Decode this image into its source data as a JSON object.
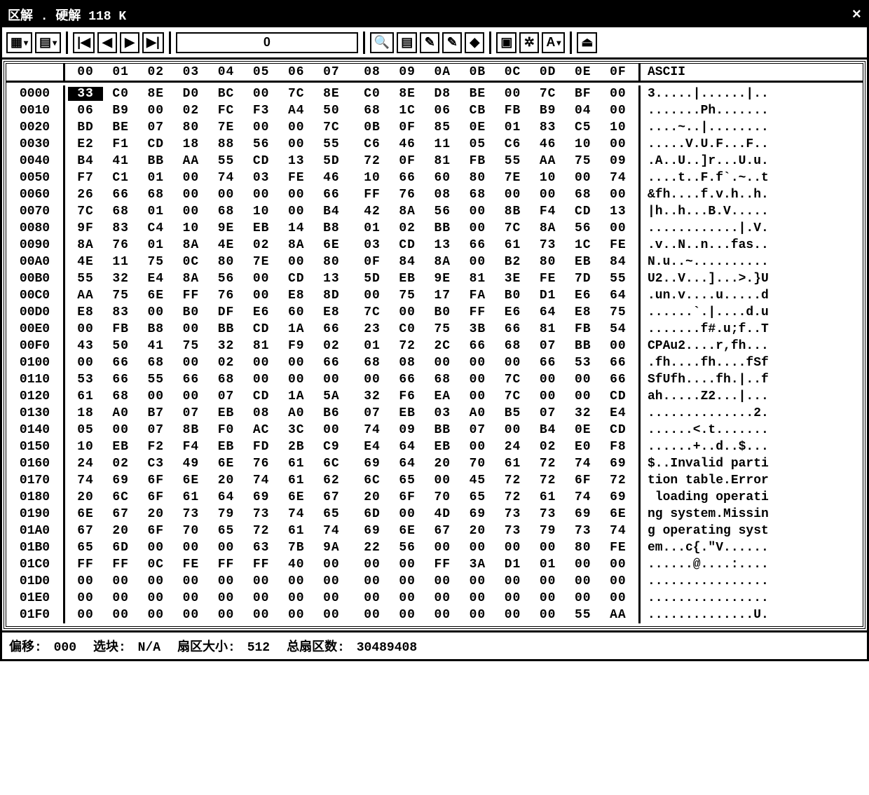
{
  "title": "区解 . 硬解 118 K",
  "close_label": "×",
  "toolbar": {
    "offset_value": "0"
  },
  "header": {
    "cols": [
      "00",
      "01",
      "02",
      "03",
      "04",
      "05",
      "06",
      "07",
      "08",
      "09",
      "0A",
      "0B",
      "0C",
      "0D",
      "0E",
      "0F"
    ],
    "ascii_label": "ASCII"
  },
  "rows": [
    {
      "addr": "0000",
      "hex": [
        "33",
        "C0",
        "8E",
        "D0",
        "BC",
        "00",
        "7C",
        "8E",
        "C0",
        "8E",
        "D8",
        "BE",
        "00",
        "7C",
        "BF",
        "00"
      ],
      "ascii": "3.....|......|.."
    },
    {
      "addr": "0010",
      "hex": [
        "06",
        "B9",
        "00",
        "02",
        "FC",
        "F3",
        "A4",
        "50",
        "68",
        "1C",
        "06",
        "CB",
        "FB",
        "B9",
        "04",
        "00"
      ],
      "ascii": ".......Ph......."
    },
    {
      "addr": "0020",
      "hex": [
        "BD",
        "BE",
        "07",
        "80",
        "7E",
        "00",
        "00",
        "7C",
        "0B",
        "0F",
        "85",
        "0E",
        "01",
        "83",
        "C5",
        "10"
      ],
      "ascii": "....~..|........"
    },
    {
      "addr": "0030",
      "hex": [
        "E2",
        "F1",
        "CD",
        "18",
        "88",
        "56",
        "00",
        "55",
        "C6",
        "46",
        "11",
        "05",
        "C6",
        "46",
        "10",
        "00"
      ],
      "ascii": ".....V.U.F...F.."
    },
    {
      "addr": "0040",
      "hex": [
        "B4",
        "41",
        "BB",
        "AA",
        "55",
        "CD",
        "13",
        "5D",
        "72",
        "0F",
        "81",
        "FB",
        "55",
        "AA",
        "75",
        "09"
      ],
      "ascii": ".A..U..]r...U.u."
    },
    {
      "addr": "0050",
      "hex": [
        "F7",
        "C1",
        "01",
        "00",
        "74",
        "03",
        "FE",
        "46",
        "10",
        "66",
        "60",
        "80",
        "7E",
        "10",
        "00",
        "74"
      ],
      "ascii": "....t..F.f`.~..t"
    },
    {
      "addr": "0060",
      "hex": [
        "26",
        "66",
        "68",
        "00",
        "00",
        "00",
        "00",
        "66",
        "FF",
        "76",
        "08",
        "68",
        "00",
        "00",
        "68",
        "00"
      ],
      "ascii": "&fh....f.v.h..h."
    },
    {
      "addr": "0070",
      "hex": [
        "7C",
        "68",
        "01",
        "00",
        "68",
        "10",
        "00",
        "B4",
        "42",
        "8A",
        "56",
        "00",
        "8B",
        "F4",
        "CD",
        "13"
      ],
      "ascii": "|h..h...B.V....."
    },
    {
      "addr": "0080",
      "hex": [
        "9F",
        "83",
        "C4",
        "10",
        "9E",
        "EB",
        "14",
        "B8",
        "01",
        "02",
        "BB",
        "00",
        "7C",
        "8A",
        "56",
        "00"
      ],
      "ascii": "............|.V."
    },
    {
      "addr": "0090",
      "hex": [
        "8A",
        "76",
        "01",
        "8A",
        "4E",
        "02",
        "8A",
        "6E",
        "03",
        "CD",
        "13",
        "66",
        "61",
        "73",
        "1C",
        "FE"
      ],
      "ascii": ".v..N..n...fas.."
    },
    {
      "addr": "00A0",
      "hex": [
        "4E",
        "11",
        "75",
        "0C",
        "80",
        "7E",
        "00",
        "80",
        "0F",
        "84",
        "8A",
        "00",
        "B2",
        "80",
        "EB",
        "84"
      ],
      "ascii": "N.u..~.........."
    },
    {
      "addr": "00B0",
      "hex": [
        "55",
        "32",
        "E4",
        "8A",
        "56",
        "00",
        "CD",
        "13",
        "5D",
        "EB",
        "9E",
        "81",
        "3E",
        "FE",
        "7D",
        "55"
      ],
      "ascii": "U2..V...]...>.}U"
    },
    {
      "addr": "00C0",
      "hex": [
        "AA",
        "75",
        "6E",
        "FF",
        "76",
        "00",
        "E8",
        "8D",
        "00",
        "75",
        "17",
        "FA",
        "B0",
        "D1",
        "E6",
        "64"
      ],
      "ascii": ".un.v....u.....d"
    },
    {
      "addr": "00D0",
      "hex": [
        "E8",
        "83",
        "00",
        "B0",
        "DF",
        "E6",
        "60",
        "E8",
        "7C",
        "00",
        "B0",
        "FF",
        "E6",
        "64",
        "E8",
        "75"
      ],
      "ascii": "......`.|....d.u"
    },
    {
      "addr": "00E0",
      "hex": [
        "00",
        "FB",
        "B8",
        "00",
        "BB",
        "CD",
        "1A",
        "66",
        "23",
        "C0",
        "75",
        "3B",
        "66",
        "81",
        "FB",
        "54"
      ],
      "ascii": ".......f#.u;f..T"
    },
    {
      "addr": "00F0",
      "hex": [
        "43",
        "50",
        "41",
        "75",
        "32",
        "81",
        "F9",
        "02",
        "01",
        "72",
        "2C",
        "66",
        "68",
        "07",
        "BB",
        "00"
      ],
      "ascii": "CPAu2....r,fh..."
    },
    {
      "addr": "0100",
      "hex": [
        "00",
        "66",
        "68",
        "00",
        "02",
        "00",
        "00",
        "66",
        "68",
        "08",
        "00",
        "00",
        "00",
        "66",
        "53",
        "66"
      ],
      "ascii": ".fh....fh....fSf"
    },
    {
      "addr": "0110",
      "hex": [
        "53",
        "66",
        "55",
        "66",
        "68",
        "00",
        "00",
        "00",
        "00",
        "66",
        "68",
        "00",
        "7C",
        "00",
        "00",
        "66"
      ],
      "ascii": "SfUfh....fh.|..f"
    },
    {
      "addr": "0120",
      "hex": [
        "61",
        "68",
        "00",
        "00",
        "07",
        "CD",
        "1A",
        "5A",
        "32",
        "F6",
        "EA",
        "00",
        "7C",
        "00",
        "00",
        "CD"
      ],
      "ascii": "ah.....Z2...|..."
    },
    {
      "addr": "0130",
      "hex": [
        "18",
        "A0",
        "B7",
        "07",
        "EB",
        "08",
        "A0",
        "B6",
        "07",
        "EB",
        "03",
        "A0",
        "B5",
        "07",
        "32",
        "E4"
      ],
      "ascii": "..............2."
    },
    {
      "addr": "0140",
      "hex": [
        "05",
        "00",
        "07",
        "8B",
        "F0",
        "AC",
        "3C",
        "00",
        "74",
        "09",
        "BB",
        "07",
        "00",
        "B4",
        "0E",
        "CD"
      ],
      "ascii": "......<.t......."
    },
    {
      "addr": "0150",
      "hex": [
        "10",
        "EB",
        "F2",
        "F4",
        "EB",
        "FD",
        "2B",
        "C9",
        "E4",
        "64",
        "EB",
        "00",
        "24",
        "02",
        "E0",
        "F8"
      ],
      "ascii": "......+..d..$..."
    },
    {
      "addr": "0160",
      "hex": [
        "24",
        "02",
        "C3",
        "49",
        "6E",
        "76",
        "61",
        "6C",
        "69",
        "64",
        "20",
        "70",
        "61",
        "72",
        "74",
        "69"
      ],
      "ascii": "$..Invalid parti"
    },
    {
      "addr": "0170",
      "hex": [
        "74",
        "69",
        "6F",
        "6E",
        "20",
        "74",
        "61",
        "62",
        "6C",
        "65",
        "00",
        "45",
        "72",
        "72",
        "6F",
        "72"
      ],
      "ascii": "tion table.Error"
    },
    {
      "addr": "0180",
      "hex": [
        "20",
        "6C",
        "6F",
        "61",
        "64",
        "69",
        "6E",
        "67",
        "20",
        "6F",
        "70",
        "65",
        "72",
        "61",
        "74",
        "69"
      ],
      "ascii": " loading operati"
    },
    {
      "addr": "0190",
      "hex": [
        "6E",
        "67",
        "20",
        "73",
        "79",
        "73",
        "74",
        "65",
        "6D",
        "00",
        "4D",
        "69",
        "73",
        "73",
        "69",
        "6E"
      ],
      "ascii": "ng system.Missin"
    },
    {
      "addr": "01A0",
      "hex": [
        "67",
        "20",
        "6F",
        "70",
        "65",
        "72",
        "61",
        "74",
        "69",
        "6E",
        "67",
        "20",
        "73",
        "79",
        "73",
        "74"
      ],
      "ascii": "g operating syst"
    },
    {
      "addr": "01B0",
      "hex": [
        "65",
        "6D",
        "00",
        "00",
        "00",
        "63",
        "7B",
        "9A",
        "22",
        "56",
        "00",
        "00",
        "00",
        "00",
        "80",
        "FE"
      ],
      "ascii": "em...c{.\"V......"
    },
    {
      "addr": "01C0",
      "hex": [
        "FF",
        "FF",
        "0C",
        "FE",
        "FF",
        "FF",
        "40",
        "00",
        "00",
        "00",
        "FF",
        "3A",
        "D1",
        "01",
        "00",
        "00"
      ],
      "ascii": "......@....:...."
    },
    {
      "addr": "01D0",
      "hex": [
        "00",
        "00",
        "00",
        "00",
        "00",
        "00",
        "00",
        "00",
        "00",
        "00",
        "00",
        "00",
        "00",
        "00",
        "00",
        "00"
      ],
      "ascii": "................"
    },
    {
      "addr": "01E0",
      "hex": [
        "00",
        "00",
        "00",
        "00",
        "00",
        "00",
        "00",
        "00",
        "00",
        "00",
        "00",
        "00",
        "00",
        "00",
        "00",
        "00"
      ],
      "ascii": "................"
    },
    {
      "addr": "01F0",
      "hex": [
        "00",
        "00",
        "00",
        "00",
        "00",
        "00",
        "00",
        "00",
        "00",
        "00",
        "00",
        "00",
        "00",
        "00",
        "55",
        "AA"
      ],
      "ascii": "..............U."
    }
  ],
  "status": {
    "offset_label": "偏移:",
    "offset_value": "000",
    "block_label": "选块:",
    "block_value": "N/A",
    "sector_size_label": "扇区大小:",
    "sector_size_value": "512",
    "total_sectors_label": "总扇区数:",
    "total_sectors_value": "30489408"
  }
}
